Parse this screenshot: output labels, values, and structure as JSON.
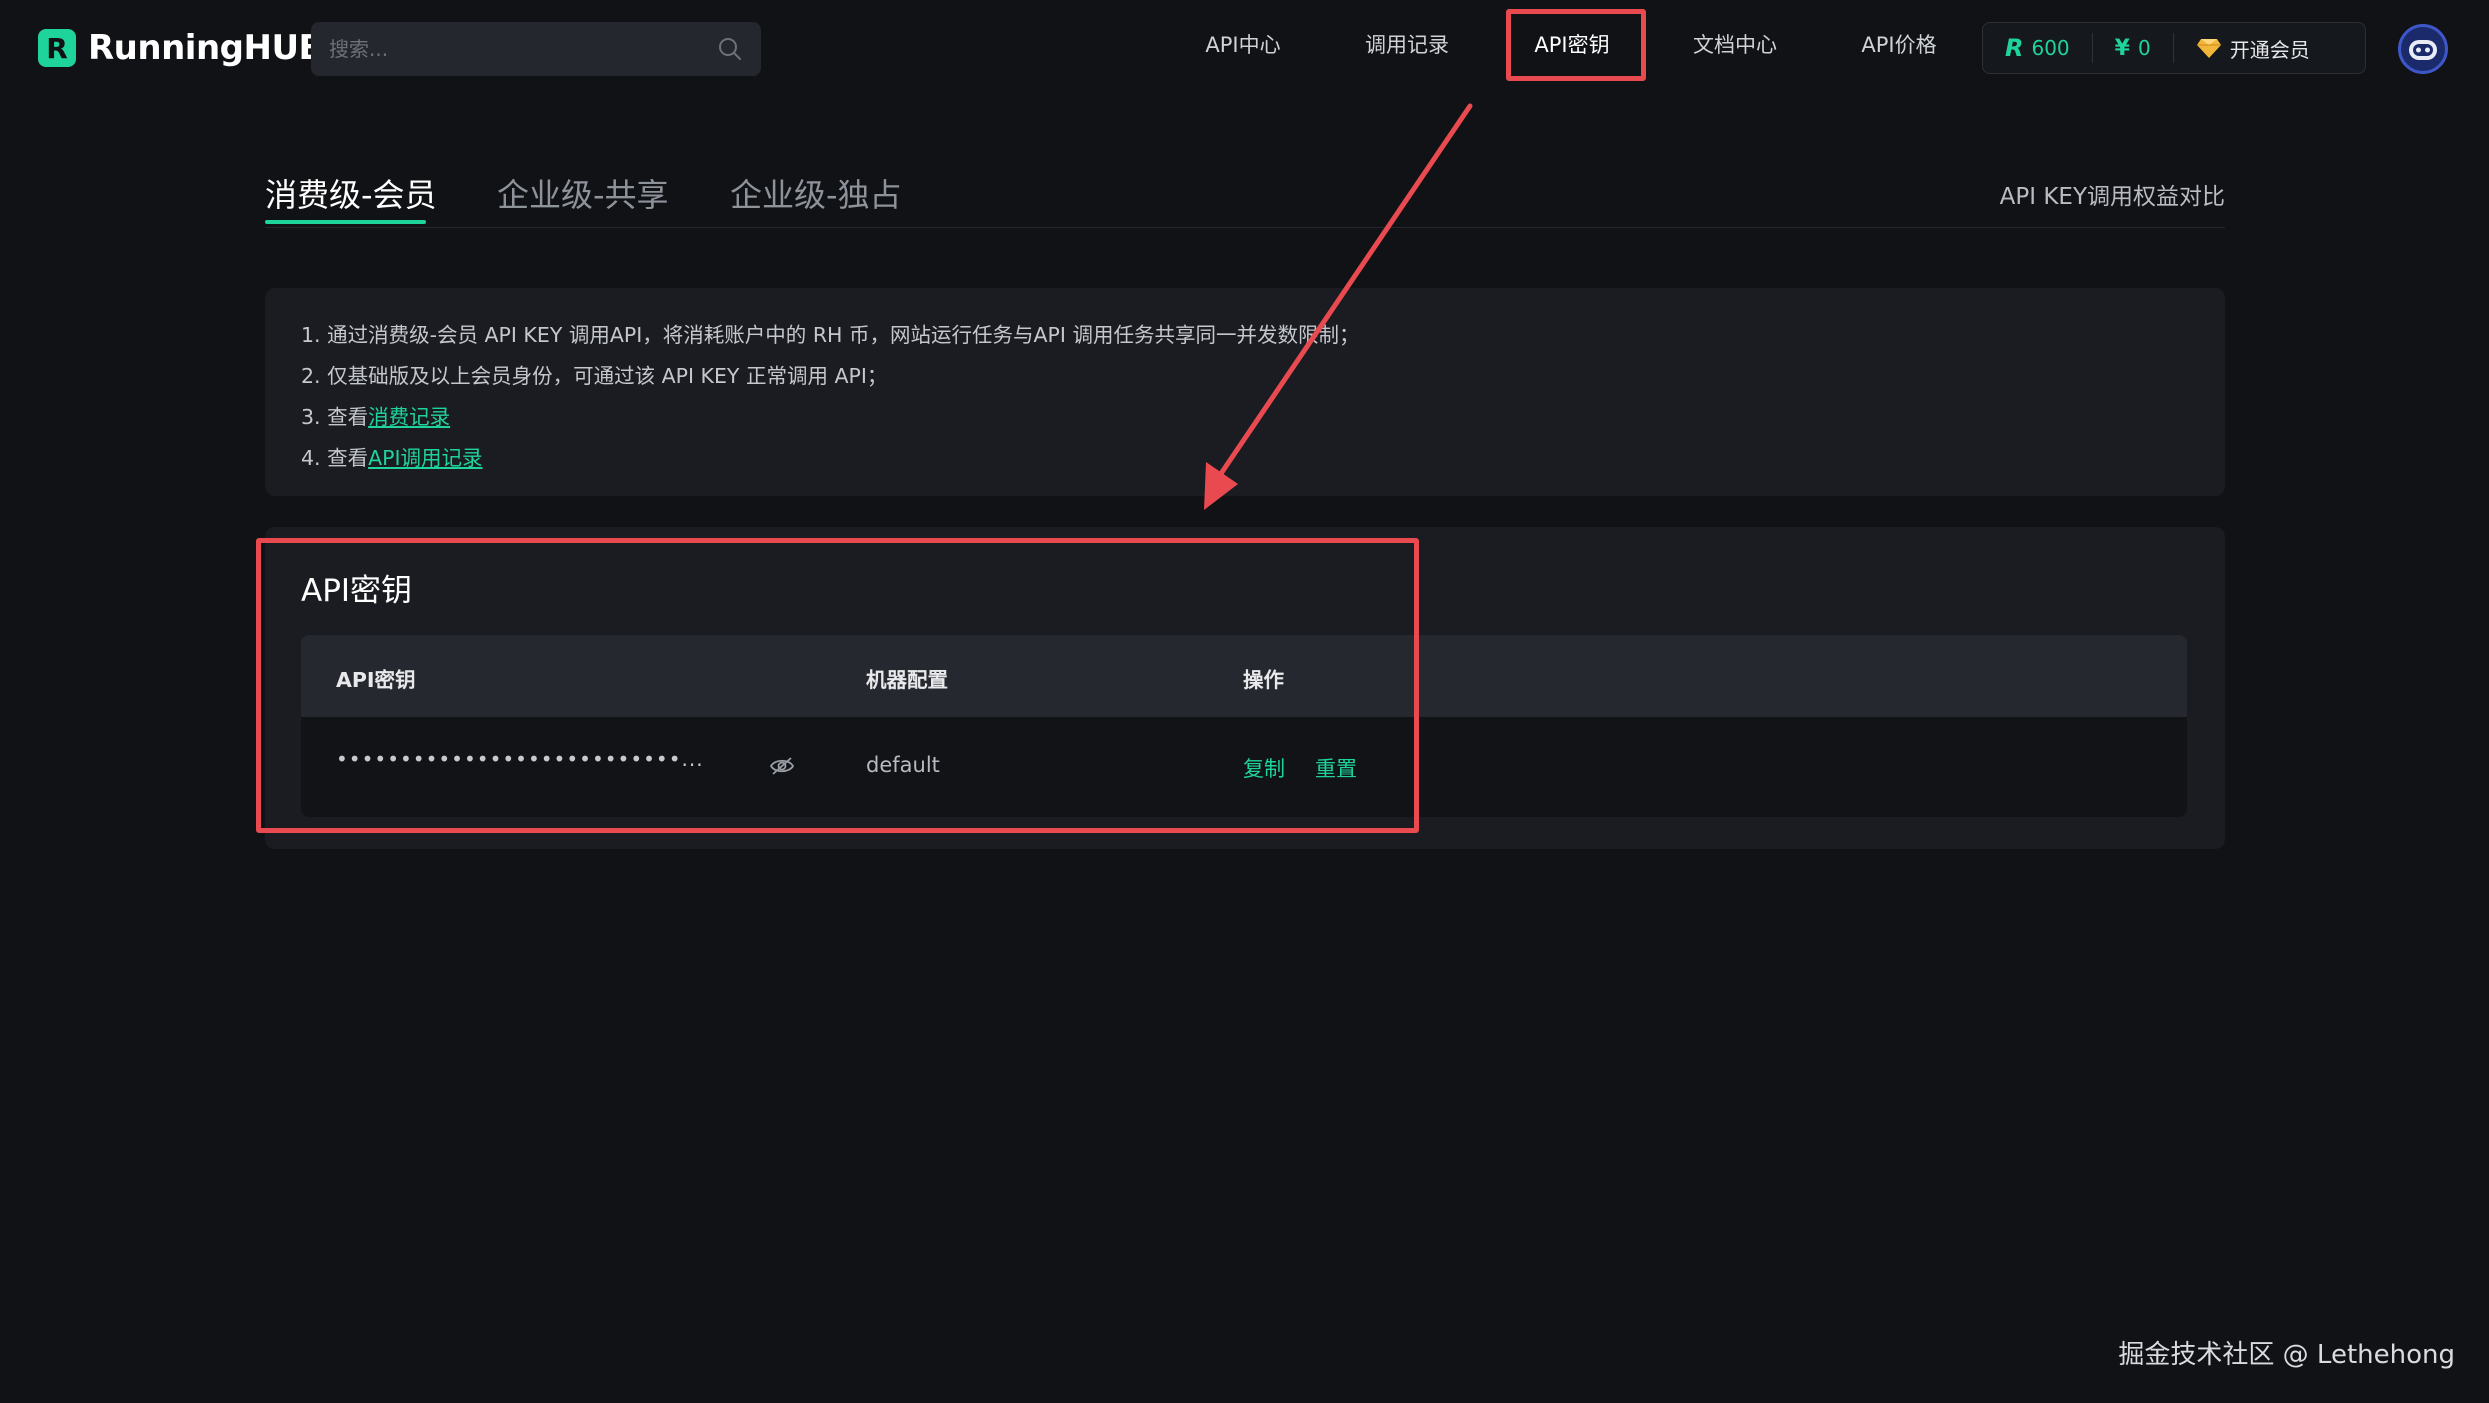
{
  "app": {
    "logo_mark": "R",
    "name": "RunningHUB"
  },
  "search": {
    "placeholder": "搜索..."
  },
  "nav": {
    "items": [
      {
        "label": "API中心"
      },
      {
        "label": "调用记录"
      },
      {
        "label": "API密钥",
        "active": true
      },
      {
        "label": "文档中心"
      },
      {
        "label": "API价格"
      }
    ]
  },
  "wallet": {
    "coins_icon": "R",
    "coins": "600",
    "cash_icon": "¥",
    "cash": "0",
    "vip_label": "开通会员"
  },
  "tabs": {
    "items": [
      {
        "label": "消费级-会员",
        "active": true
      },
      {
        "label": "企业级-共享"
      },
      {
        "label": "企业级-独占"
      }
    ],
    "compare_link": "API KEY调用权益对比"
  },
  "notice": {
    "line1": "1. 通过消费级-会员 API KEY 调用API，将消耗账户中的 RH 币，网站运行任务与API 调用任务共享同一并发数限制；",
    "line2": "2. 仅基础版及以上会员身份，可通过该 API KEY 正常调用 API；",
    "line3_prefix": "3. 查看",
    "line3_link": "消费记录",
    "line4_prefix": "4. 查看",
    "line4_link": "API调用记录"
  },
  "api_keys": {
    "title": "API密钥",
    "columns": [
      "API密钥",
      "机器配置",
      "操作"
    ],
    "rows": [
      {
        "key_masked": "•••••••••••••••••••••••••••...",
        "machine_config": "default",
        "actions": [
          "复制",
          "重置"
        ]
      }
    ]
  },
  "watermark": "掘金技术社区 @ Lethehong",
  "colors": {
    "accent": "#1fd49a",
    "background": "#101216",
    "card": "#1a1c21",
    "annotation": "#e84a50"
  }
}
